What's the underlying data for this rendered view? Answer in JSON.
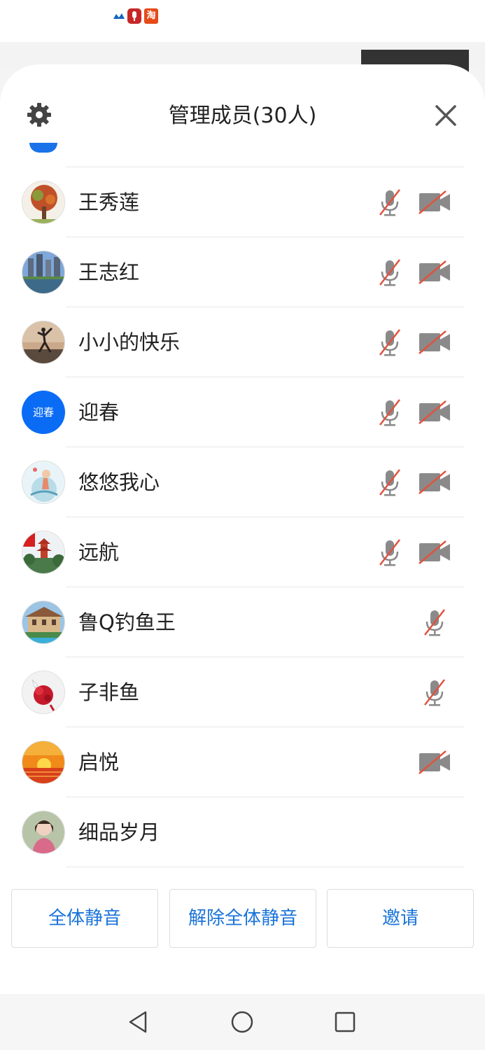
{
  "status_bar": {
    "icons": [
      "wave-icon",
      "mic-app-icon",
      "taobao-icon"
    ],
    "taobao_glyph": "淘"
  },
  "header": {
    "title": "管理成员(30人)",
    "settings_icon": "gear-icon",
    "close_icon": "close-icon"
  },
  "members": [
    {
      "name": "王秀莲",
      "avatar": "tree",
      "mic_muted": true,
      "camera_off": true
    },
    {
      "name": "王志红",
      "avatar": "city",
      "mic_muted": true,
      "camera_off": true
    },
    {
      "name": "小小的快乐",
      "avatar": "dancer",
      "mic_muted": true,
      "camera_off": true
    },
    {
      "name": "迎春",
      "avatar_text": "迎春",
      "mic_muted": true,
      "camera_off": true
    },
    {
      "name": "悠悠我心",
      "avatar": "cartoon",
      "mic_muted": true,
      "camera_off": true
    },
    {
      "name": "远航",
      "avatar": "pavilion",
      "mic_muted": true,
      "camera_off": true
    },
    {
      "name": "鲁Q钓鱼王",
      "avatar": "villa",
      "mic_muted": true,
      "camera_off": false
    },
    {
      "name": "子非鱼",
      "avatar": "flowers",
      "mic_muted": true,
      "camera_off": false
    },
    {
      "name": "启悦",
      "avatar": "sunset",
      "mic_muted": false,
      "camera_off": true
    },
    {
      "name": "细品岁月",
      "avatar": "portrait",
      "mic_muted": false,
      "camera_off": false
    }
  ],
  "actions": {
    "mute_all": "全体静音",
    "unmute_all": "解除全体静音",
    "invite": "邀请"
  },
  "colors": {
    "accent_blue": "#1a73d9",
    "avatar_blue": "#0a6cf5",
    "muted_slash": "#e0533f",
    "icon_gray": "#8a8a8a"
  },
  "nav": {
    "back_icon": "back-triangle-icon",
    "home_icon": "home-circle-icon",
    "recents_icon": "recents-square-icon"
  }
}
